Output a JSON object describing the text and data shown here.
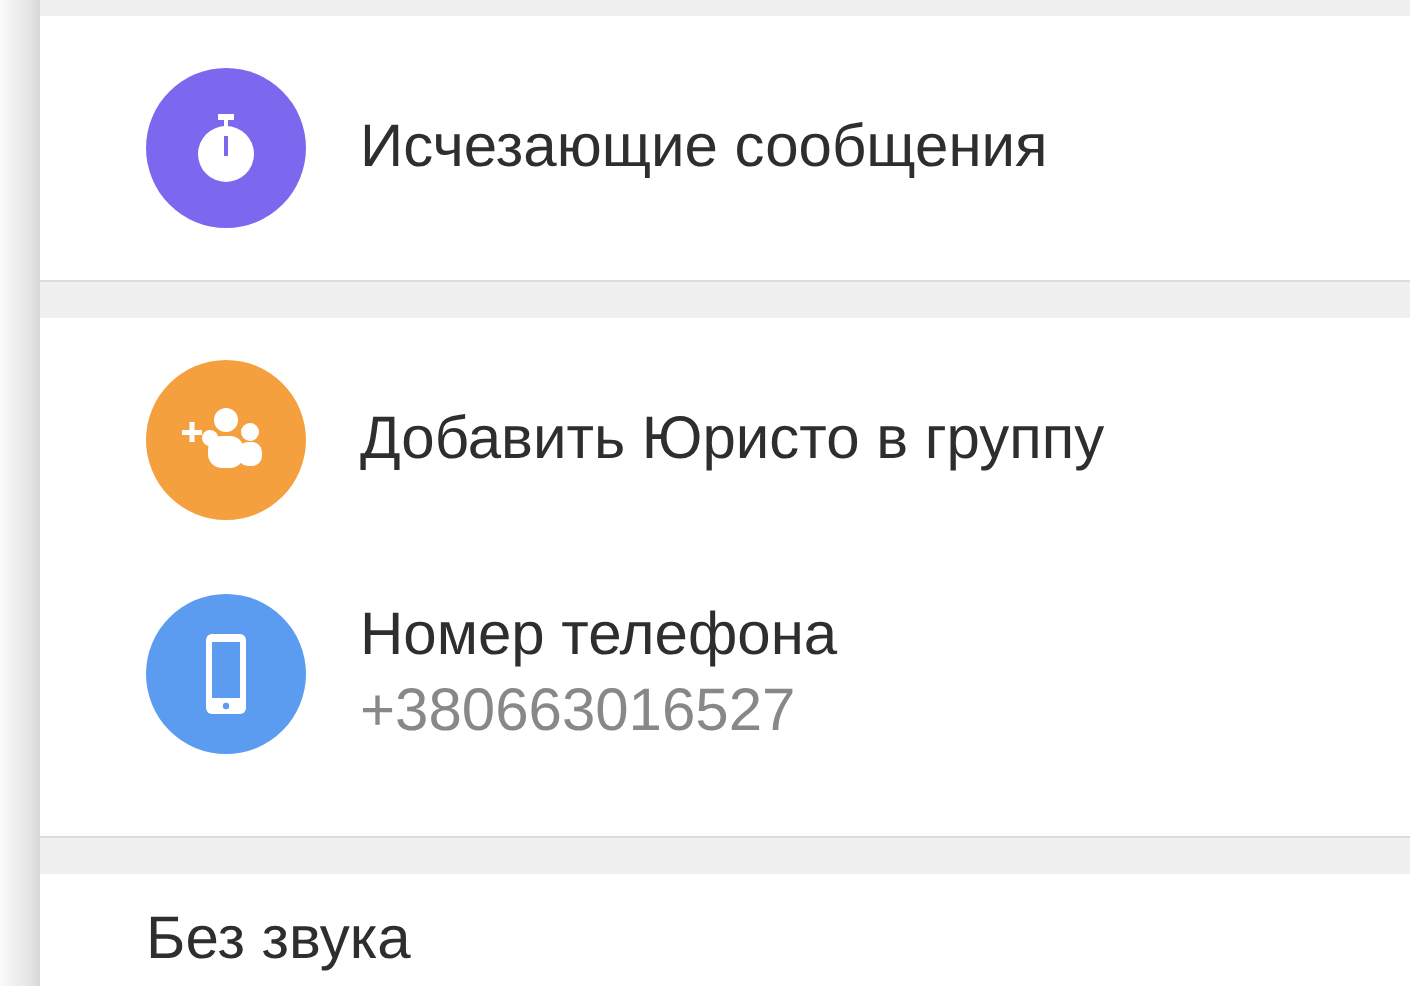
{
  "sections": [
    {
      "items": [
        {
          "kind": "timer",
          "color": "#7b68ee",
          "title": "Исчезающие сообщения"
        }
      ]
    },
    {
      "items": [
        {
          "kind": "add-group",
          "color": "#f4a03e",
          "title": "Добавить Юристо в группу"
        },
        {
          "kind": "phone",
          "color": "#5b9bf0",
          "title": "Номер телефона",
          "subtitle": "+380663016527"
        }
      ]
    },
    {
      "items": [
        {
          "kind": "plain",
          "title": "Без звука"
        }
      ]
    }
  ]
}
